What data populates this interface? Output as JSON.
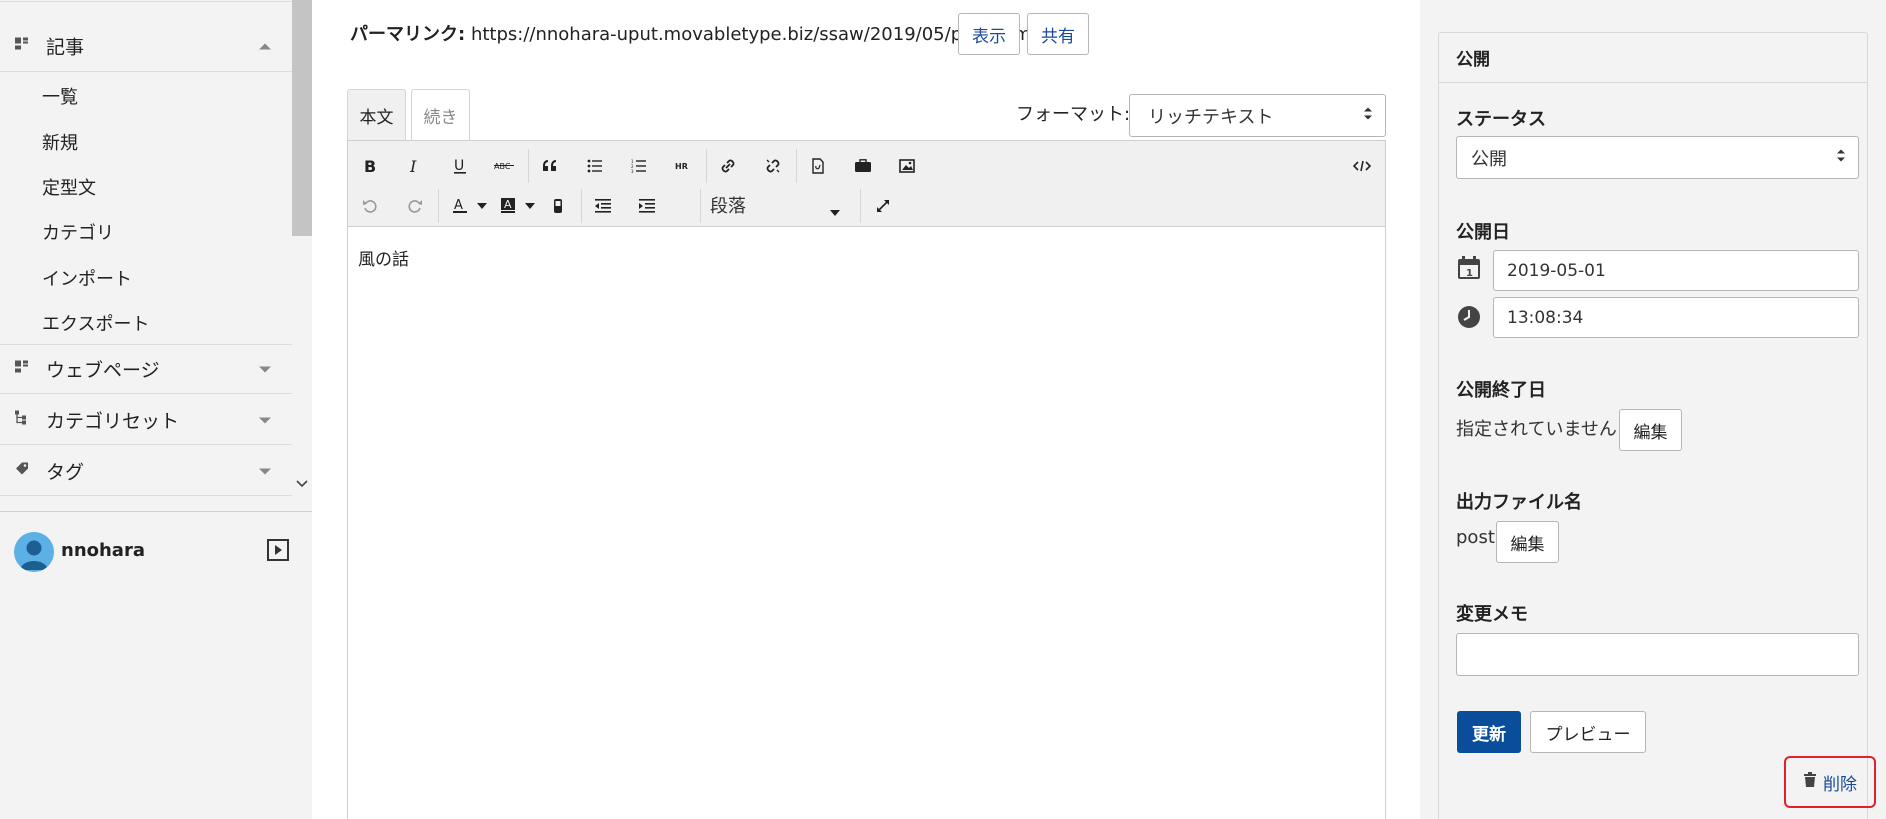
{
  "sidebar": {
    "menu": [
      {
        "label": "記事",
        "icon": "entries-icon",
        "expanded": true
      },
      {
        "label": "ウェブページ",
        "icon": "pages-icon",
        "expanded": false
      },
      {
        "label": "カテゴリセット",
        "icon": "category-set-icon",
        "expanded": false
      },
      {
        "label": "タグ",
        "icon": "tag-icon",
        "expanded": false
      }
    ],
    "entry_items": [
      "一覧",
      "新規",
      "定型文",
      "カテゴリ",
      "インポート",
      "エクスポート"
    ],
    "user": {
      "name": "nnohara"
    }
  },
  "main": {
    "permalink_label": "パーマリンク:",
    "permalink_url": "https://nnohara-uput.movabletype.biz/ssaw/2019/05/post.html",
    "view_button": "表示",
    "share_button": "共有",
    "tabs": [
      {
        "label": "本文",
        "active": true
      },
      {
        "label": "続き",
        "active": false
      }
    ],
    "format_label": "フォーマット:",
    "format_value": "リッチテキスト",
    "paragraph_value": "段落",
    "body_text": "風の話"
  },
  "publish_panel": {
    "title": "公開",
    "status_label": "ステータス",
    "status_value": "公開",
    "publish_date_label": "公開日",
    "date_value": "2019-05-01",
    "time_value": "13:08:34",
    "unpublish_label": "公開終了日",
    "unpublish_value": "指定されていません",
    "edit_label": "編集",
    "filename_label": "出力ファイル名",
    "filename_value": "post",
    "memo_label": "変更メモ",
    "memo_value": "",
    "update_button": "更新",
    "preview_button": "プレビュー",
    "delete_button": "削除"
  },
  "colors": {
    "primary": "#0a4d9a",
    "link": "#1a4a9a",
    "highlight": "#e0202b",
    "sidebar_bg": "#f3f3f3"
  }
}
